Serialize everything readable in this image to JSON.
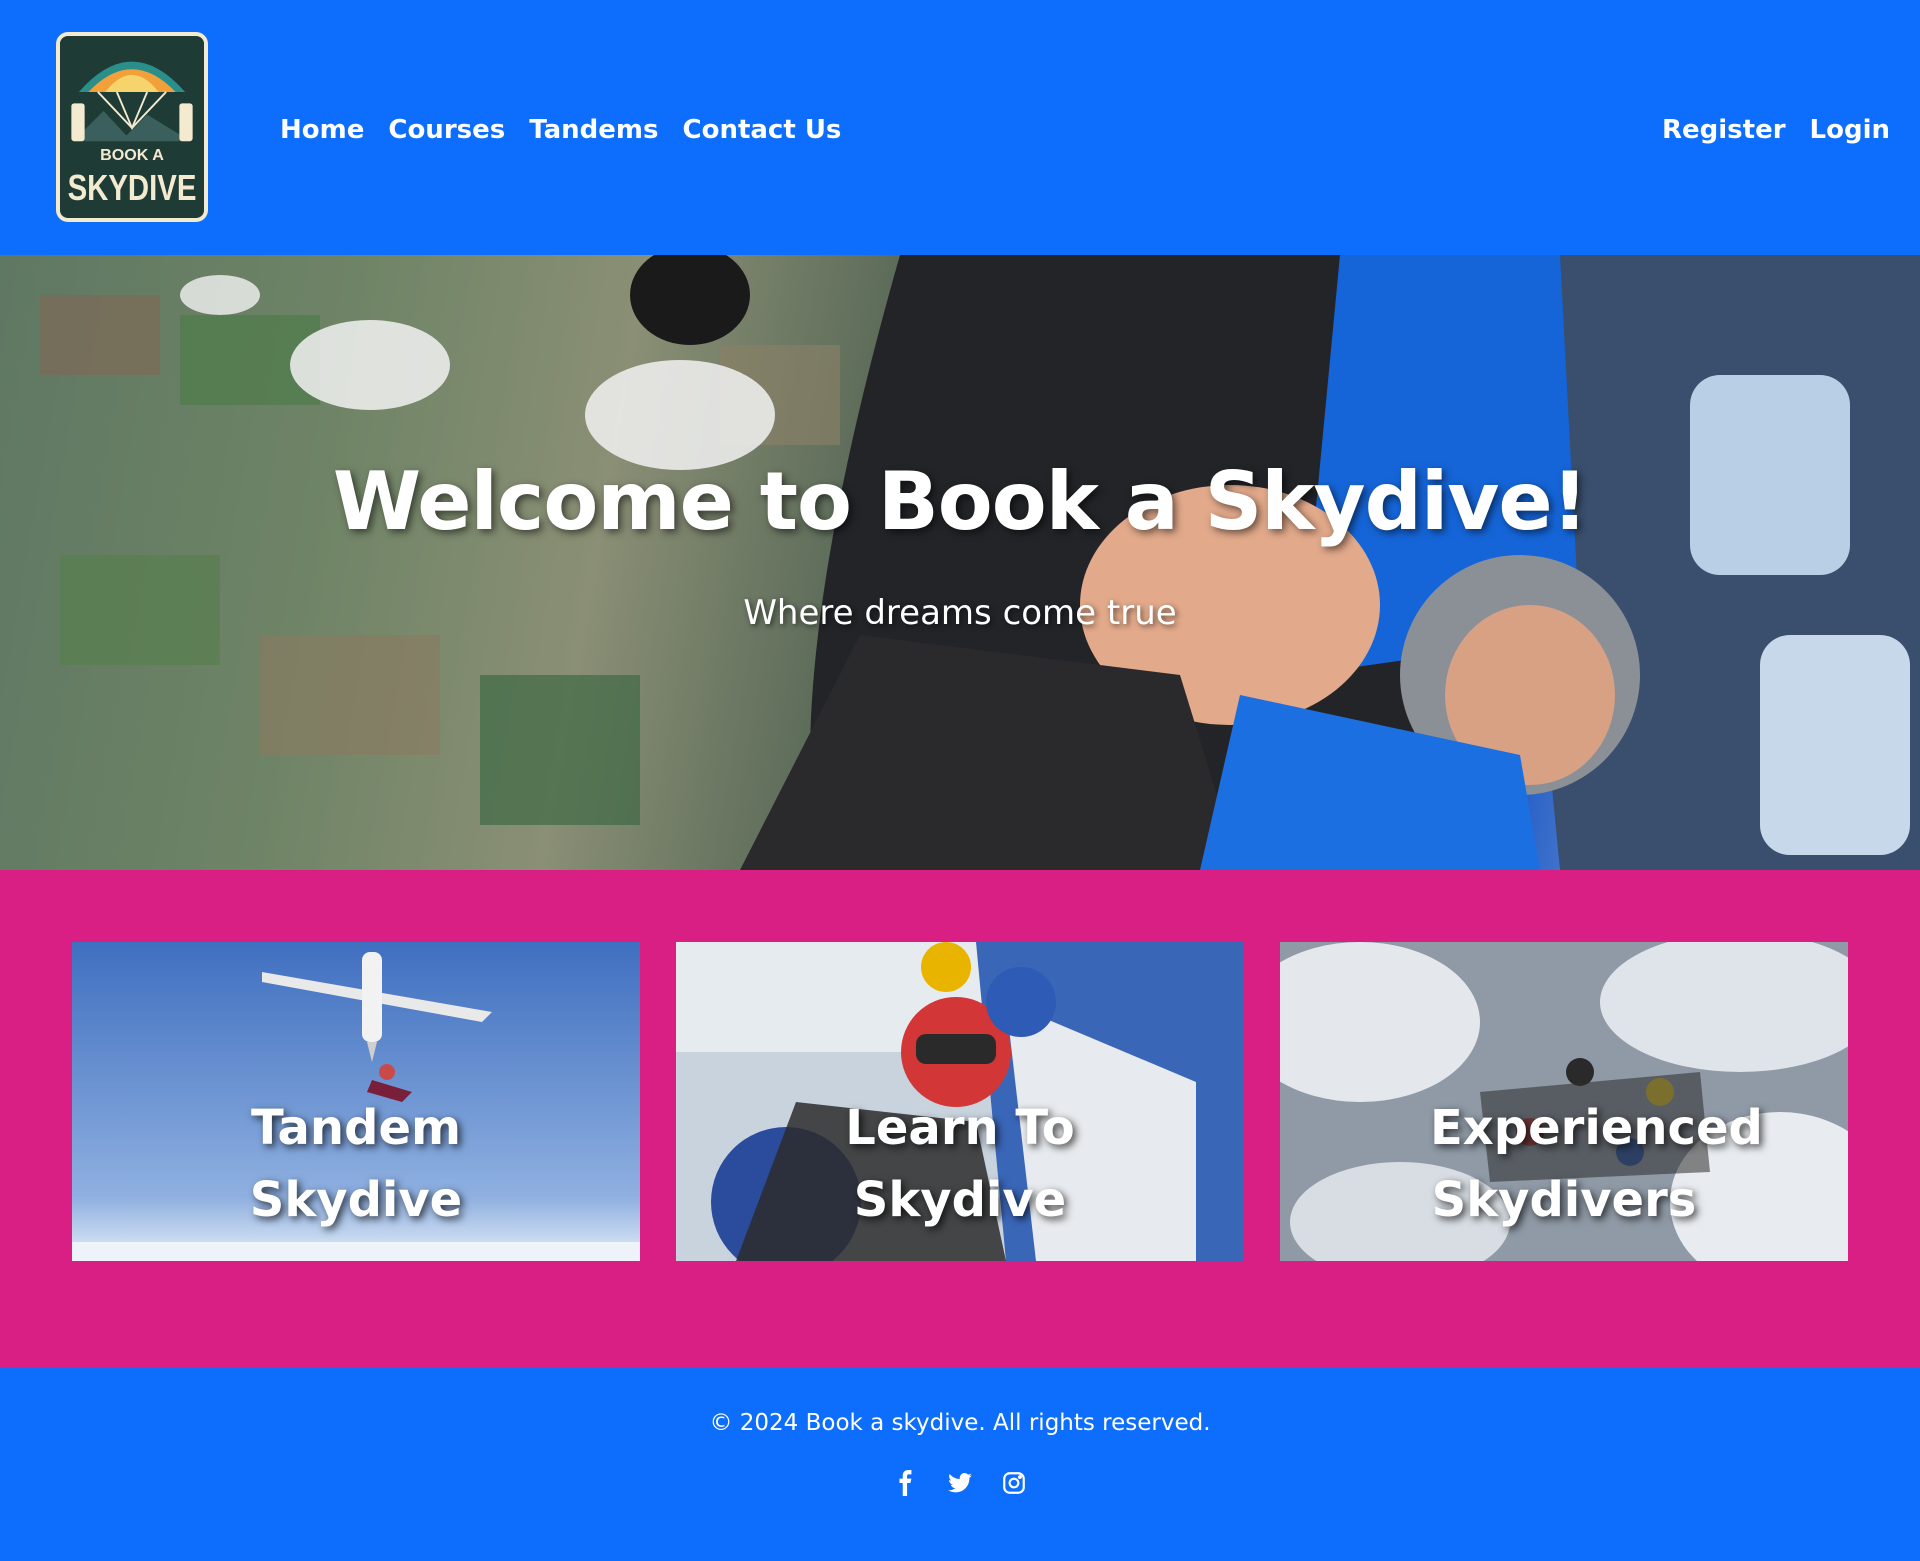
{
  "header": {
    "logo_top_text": "BOOK A",
    "logo_main_text": "SKYDIVE",
    "nav_left": [
      {
        "label": "Home"
      },
      {
        "label": "Courses"
      },
      {
        "label": "Tandems"
      },
      {
        "label": "Contact Us"
      }
    ],
    "nav_right": [
      {
        "label": "Register"
      },
      {
        "label": "Login"
      }
    ]
  },
  "hero": {
    "title": "Welcome to Book a Skydive!",
    "subtitle": "Where dreams come true"
  },
  "cards": [
    {
      "title": "Tandem Skydive"
    },
    {
      "title": "Learn To Skydive"
    },
    {
      "title": "Experienced Skydivers"
    }
  ],
  "footer": {
    "copyright": "© 2024 Book a skydive. All rights reserved.",
    "socials": [
      "facebook-icon",
      "twitter-icon",
      "instagram-icon"
    ]
  },
  "colors": {
    "primary_blue": "#0d6efd",
    "section_pink": "#d91e84",
    "text_white": "#ffffff"
  }
}
